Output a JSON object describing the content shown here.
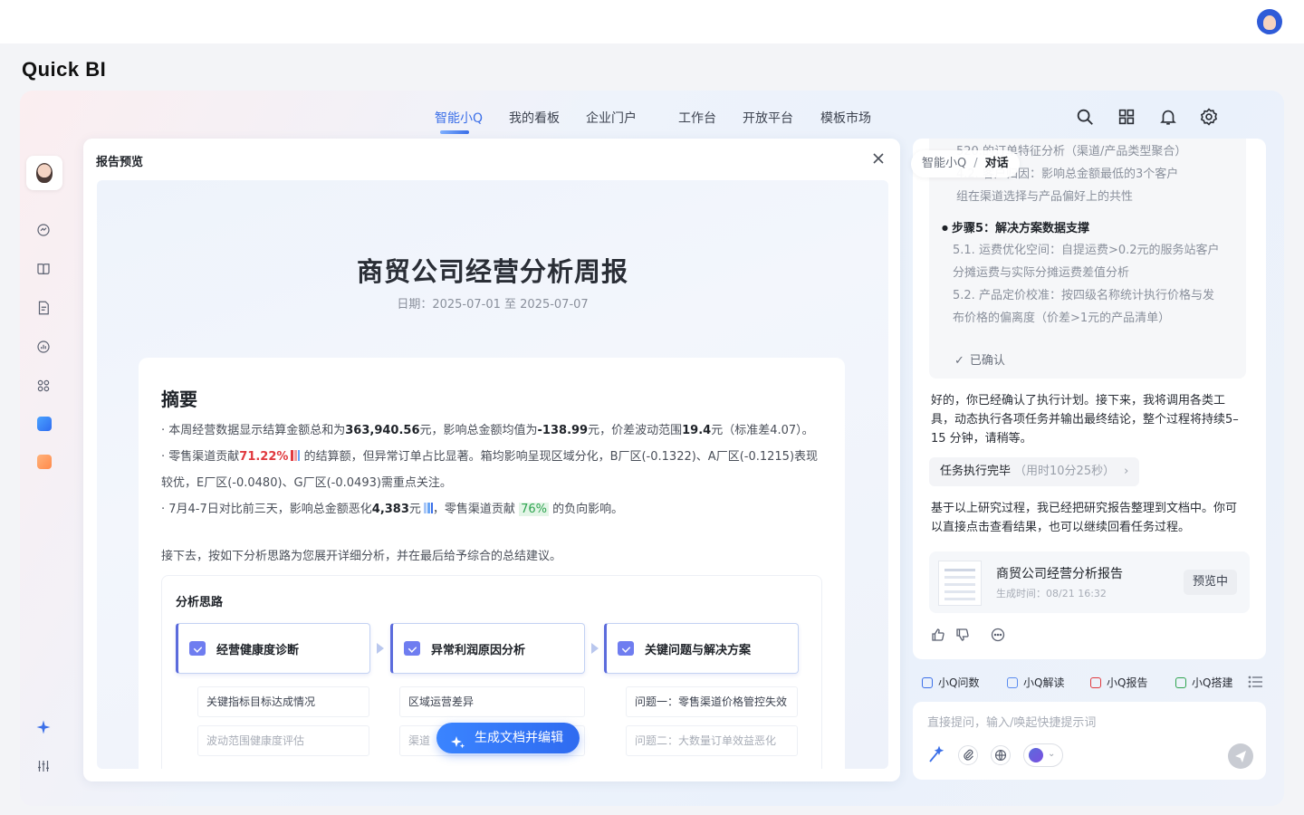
{
  "brand": "Quick BI",
  "nav": {
    "items": [
      {
        "label": "智能小Q",
        "active": true
      },
      {
        "label": "我的看板"
      },
      {
        "label": "企业门户"
      },
      {
        "label": "工作台"
      },
      {
        "label": "开放平台"
      },
      {
        "label": "模板市场"
      }
    ],
    "icons": [
      "search-icon",
      "grid-icon",
      "bell-icon",
      "gear-icon"
    ]
  },
  "rail": {
    "icons": [
      "chat-data-icon",
      "book-icon",
      "report-icon",
      "dashboard-icon",
      "apps-icon",
      "blue-app-badge",
      "orange-app-badge",
      "sparkle-icon",
      "sliders-icon"
    ]
  },
  "preview": {
    "title": "报告预览",
    "report_title": "商贸公司经营分析周报",
    "report_date": "日期：2025-07-01 至 2025-07-07",
    "summary_heading": "摘要",
    "s1": {
      "a": "· 本周经营数据显示结算金额总和为",
      "b": "363,940.56",
      "c": "元，影响总金额均值为",
      "d": "-138.99",
      "e": "元，价差波动范围",
      "f": "19.4",
      "g": "元（标准差4.07）。"
    },
    "s2": {
      "a": "· 零售渠道",
      "b": "贡献",
      "c": "71.22%",
      "d": " 的结算额，但异常订单占比显著。箱均影响呈现区域分化，B厂区(-0.1322)、A厂区(-0.1215)表现较优，E厂区(-0.0480)、G厂区(-0.0493)需重点关注。"
    },
    "s3": {
      "a": "· 7月4-7日对比前三天，影响总金额恶化",
      "b": "4,383",
      "c": "元",
      "d": "，零售渠道贡献 ",
      "e": "76%",
      "f": " 的负向影响。"
    },
    "intro": "接下去，按如下分析思路为您展开详细分析，并在最后给予综合的总结建议。",
    "analysis_heading": "分析思路",
    "steps": [
      {
        "label": "经营健康度诊断",
        "subs": [
          "关键指标目标达成情况",
          "波动范围健康度评估"
        ]
      },
      {
        "label": "异常利润原因分析",
        "subs": [
          "区域运营差异",
          "渠道"
        ]
      },
      {
        "label": "关键问题与解决方案",
        "subs": [
          "问题一：零售渠道价格管控失效",
          "问题二：大数量订单效益恶化"
        ]
      }
    ],
    "generate_button": "生成文档并编辑"
  },
  "chat": {
    "breadcrumb": {
      "root": "智能小Q",
      "sep": "/",
      "current": "对话"
    },
    "plan_faded": [
      "520.的订单特征分析（渠道/产品类型聚合）",
      "4.2. 客户归因：影响总金额最低的3个客户",
      "组在渠道选择与产品偏好上的共性"
    ],
    "plan_step": "步骤5：解决方案数据支撑",
    "plan_subs": [
      "5.1. 运费优化空间：自提运费>0.2元的服务站客户分摊运费与实际分摊运费差值分析",
      "5.2. 产品定价校准：按四级名称统计执行价格与发布价格的偏离度（价差>1元的产品清单）"
    ],
    "confirmed": "已确认",
    "msg1": "好的，你已经确认了执行计划。接下来，我将调用各类工具，动态执行各项任务并输出最终结论，整个过程将持续5–15 分钟，请稍等。",
    "task": {
      "label": "任务执行完毕",
      "time": "（用时10分25秒）",
      "chevron": "›"
    },
    "msg2": "基于以上研究过程，我已经把研究报告整理到文档中。你可以直接点击查看结果，也可以继续回看任务过程。",
    "doc": {
      "name": "商贸公司经营分析报告",
      "time": "生成时间：08/21 16:32",
      "status": "预览中"
    },
    "quick_actions": [
      {
        "label": "小Q问数",
        "color": "#3b6fe8"
      },
      {
        "label": "小Q解读",
        "color": "#5b8cf0"
      },
      {
        "label": "小Q报告",
        "color": "#e0393e"
      },
      {
        "label": "小Q搭建",
        "color": "#2ea44f"
      }
    ],
    "input_placeholder": "直接提问，输入/唤起快捷提示词"
  }
}
